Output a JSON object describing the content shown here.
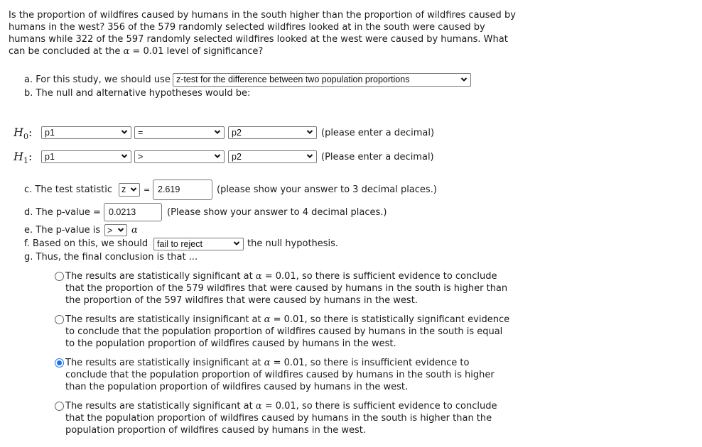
{
  "question": {
    "text_part1": "Is the proportion of wildfires caused by humans in the south higher than the proportion of wildfires caused by humans in the west? 356 of the 579 randomly selected wildfires looked at in the south were caused by humans while 322 of the 597 randomly selected wildfires looked at the west were caused by humans. What can be concluded at the ",
    "alpha_symbol": "α",
    "text_part2": " = 0.01 level of significance?"
  },
  "part_a": {
    "label": "a. For this study, we should use",
    "selected": "z-test for the difference between two population proportions"
  },
  "part_b": {
    "label": "b. The null and alternative hypotheses would be:"
  },
  "hypotheses": {
    "h0": {
      "label": "H",
      "sub": "0",
      "colon": ":",
      "left": "p1",
      "operator": "=",
      "right": "p2",
      "hint": "(please enter a decimal)"
    },
    "h1": {
      "label": "H",
      "sub": "1",
      "colon": ":",
      "left": "p1",
      "operator": ">",
      "right": "p2",
      "hint": "(Please enter a decimal)"
    }
  },
  "part_c": {
    "label": "c. The test statistic",
    "statistic": "z",
    "equals": "=",
    "value": "2.619",
    "hint": "(please show your answer to 3 decimal places.)"
  },
  "part_d": {
    "label": "d. The p-value =",
    "value": "0.0213",
    "hint": "(Please show your answer to 4 decimal places.)"
  },
  "part_e": {
    "label": "e. The p-value is",
    "comparison": ">",
    "alpha_symbol": "α"
  },
  "part_f": {
    "label": "f. Based on this, we should",
    "selected": "fail to reject",
    "suffix": "the null hypothesis."
  },
  "part_g": {
    "label": "g. Thus, the final conclusion is that ..."
  },
  "conclusions": [
    {
      "selected": false,
      "pre": "The results are statistically significant at ",
      "alpha": "α",
      "post": " = 0.01, so there is sufficient evidence to conclude that the proportion of the 579 wildfires that were caused by humans in the south is higher than the proportion of the 597 wildfires that were caused by humans in the west."
    },
    {
      "selected": false,
      "pre": "The results are statistically insignificant at ",
      "alpha": "α",
      "post": " = 0.01, so there is statistically significant evidence to conclude that the population proportion of wildfires caused by humans in the south is equal to the population proportion of wildfires caused by humans in the west."
    },
    {
      "selected": true,
      "pre": "The results are statistically insignificant at ",
      "alpha": "α",
      "post": " = 0.01, so there is insufficient evidence to conclude that the population proportion of wildfires caused by humans in the south is higher than the population proportion of wildfires caused by humans in the west."
    },
    {
      "selected": false,
      "pre": "The results are statistically significant at ",
      "alpha": "α",
      "post": " = 0.01, so there is sufficient evidence to conclude that the population proportion of wildfires caused by humans in the south is higher than the population proportion of wildfires caused by humans in the west."
    }
  ],
  "colors": {
    "radio_selected": "#1a73e8",
    "border": "#767676",
    "text": "#1a1a1a"
  }
}
